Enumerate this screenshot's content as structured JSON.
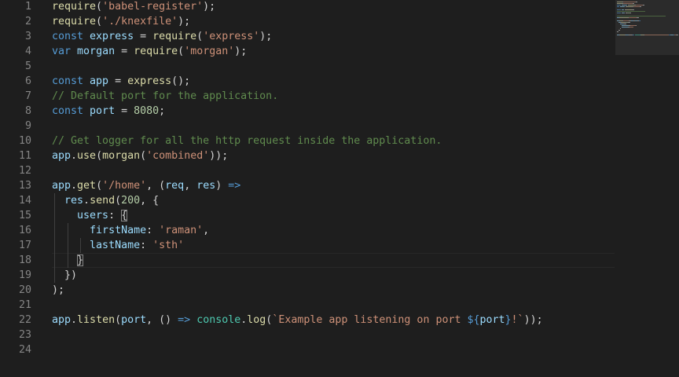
{
  "line_numbers": [
    "1",
    "2",
    "3",
    "4",
    "5",
    "6",
    "7",
    "8",
    "9",
    "10",
    "11",
    "12",
    "13",
    "14",
    "15",
    "16",
    "17",
    "18",
    "19",
    "20",
    "21",
    "22",
    "23",
    "24"
  ],
  "colors": {
    "background": "#1e1e1e",
    "line_number": "#858585",
    "keyword": "#569cd6",
    "string": "#ce9178",
    "function": "#dcdcaa",
    "variable": "#9cdcfe",
    "number": "#b5cea8",
    "comment": "#608b4e",
    "type": "#4ec9b0",
    "plain": "#d4d4d4"
  },
  "code_lines": [
    [
      {
        "t": "fn",
        "s": "require"
      },
      {
        "t": "plain",
        "s": "("
      },
      {
        "t": "str",
        "s": "'babel-register'"
      },
      {
        "t": "plain",
        "s": ");"
      }
    ],
    [
      {
        "t": "fn",
        "s": "require"
      },
      {
        "t": "plain",
        "s": "("
      },
      {
        "t": "str",
        "s": "'./knexfile'"
      },
      {
        "t": "plain",
        "s": ");"
      }
    ],
    [
      {
        "t": "kw",
        "s": "const"
      },
      {
        "t": "plain",
        "s": " "
      },
      {
        "t": "var",
        "s": "express"
      },
      {
        "t": "plain",
        "s": " = "
      },
      {
        "t": "fn",
        "s": "require"
      },
      {
        "t": "plain",
        "s": "("
      },
      {
        "t": "str",
        "s": "'express'"
      },
      {
        "t": "plain",
        "s": ");"
      }
    ],
    [
      {
        "t": "kw",
        "s": "var"
      },
      {
        "t": "plain",
        "s": " "
      },
      {
        "t": "var",
        "s": "morgan"
      },
      {
        "t": "plain",
        "s": " = "
      },
      {
        "t": "fn",
        "s": "require"
      },
      {
        "t": "plain",
        "s": "("
      },
      {
        "t": "str",
        "s": "'morgan'"
      },
      {
        "t": "plain",
        "s": ");"
      }
    ],
    [],
    [
      {
        "t": "kw",
        "s": "const"
      },
      {
        "t": "plain",
        "s": " "
      },
      {
        "t": "var",
        "s": "app"
      },
      {
        "t": "plain",
        "s": " = "
      },
      {
        "t": "fn",
        "s": "express"
      },
      {
        "t": "plain",
        "s": "();"
      }
    ],
    [
      {
        "t": "cmt",
        "s": "// Default port for the application."
      }
    ],
    [
      {
        "t": "kw",
        "s": "const"
      },
      {
        "t": "plain",
        "s": " "
      },
      {
        "t": "var",
        "s": "port"
      },
      {
        "t": "plain",
        "s": " = "
      },
      {
        "t": "num",
        "s": "8080"
      },
      {
        "t": "plain",
        "s": ";"
      }
    ],
    [],
    [
      {
        "t": "cmt",
        "s": "// Get logger for all the http request inside the application."
      }
    ],
    [
      {
        "t": "var",
        "s": "app"
      },
      {
        "t": "plain",
        "s": "."
      },
      {
        "t": "fn",
        "s": "use"
      },
      {
        "t": "plain",
        "s": "("
      },
      {
        "t": "fn",
        "s": "morgan"
      },
      {
        "t": "plain",
        "s": "("
      },
      {
        "t": "str",
        "s": "'combined'"
      },
      {
        "t": "plain",
        "s": "));"
      }
    ],
    [],
    [
      {
        "t": "var",
        "s": "app"
      },
      {
        "t": "plain",
        "s": "."
      },
      {
        "t": "fn",
        "s": "get"
      },
      {
        "t": "plain",
        "s": "("
      },
      {
        "t": "str",
        "s": "'/home'"
      },
      {
        "t": "plain",
        "s": ", ("
      },
      {
        "t": "var",
        "s": "req"
      },
      {
        "t": "plain",
        "s": ", "
      },
      {
        "t": "var",
        "s": "res"
      },
      {
        "t": "plain",
        "s": ") "
      },
      {
        "t": "kw",
        "s": "=>"
      }
    ],
    [
      {
        "t": "plain",
        "s": "  "
      },
      {
        "t": "var",
        "s": "res"
      },
      {
        "t": "plain",
        "s": "."
      },
      {
        "t": "fn",
        "s": "send"
      },
      {
        "t": "plain",
        "s": "("
      },
      {
        "t": "num",
        "s": "200"
      },
      {
        "t": "plain",
        "s": ", {"
      }
    ],
    [
      {
        "t": "plain",
        "s": "    "
      },
      {
        "t": "var",
        "s": "users"
      },
      {
        "t": "plain",
        "s": ": "
      },
      {
        "t": "bracket",
        "s": "{"
      }
    ],
    [
      {
        "t": "plain",
        "s": "      "
      },
      {
        "t": "var",
        "s": "firstName"
      },
      {
        "t": "plain",
        "s": ": "
      },
      {
        "t": "str",
        "s": "'raman'"
      },
      {
        "t": "plain",
        "s": ","
      }
    ],
    [
      {
        "t": "plain",
        "s": "      "
      },
      {
        "t": "var",
        "s": "lastName"
      },
      {
        "t": "plain",
        "s": ": "
      },
      {
        "t": "str",
        "s": "'sth'"
      }
    ],
    [
      {
        "t": "plain",
        "s": "    "
      },
      {
        "t": "bracket",
        "s": "}"
      }
    ],
    [
      {
        "t": "plain",
        "s": "  })"
      }
    ],
    [
      {
        "t": "plain",
        "s": ");"
      }
    ],
    [],
    [
      {
        "t": "var",
        "s": "app"
      },
      {
        "t": "plain",
        "s": "."
      },
      {
        "t": "fn",
        "s": "listen"
      },
      {
        "t": "plain",
        "s": "("
      },
      {
        "t": "var",
        "s": "port"
      },
      {
        "t": "plain",
        "s": ", () "
      },
      {
        "t": "kw",
        "s": "=>"
      },
      {
        "t": "plain",
        "s": " "
      },
      {
        "t": "type",
        "s": "console"
      },
      {
        "t": "plain",
        "s": "."
      },
      {
        "t": "fn",
        "s": "log"
      },
      {
        "t": "plain",
        "s": "("
      },
      {
        "t": "str",
        "s": "`Example app listening on port "
      },
      {
        "t": "kw",
        "s": "${"
      },
      {
        "t": "var",
        "s": "port"
      },
      {
        "t": "kw",
        "s": "}"
      },
      {
        "t": "str",
        "s": "!`"
      },
      {
        "t": "plain",
        "s": "));"
      }
    ],
    [],
    []
  ]
}
